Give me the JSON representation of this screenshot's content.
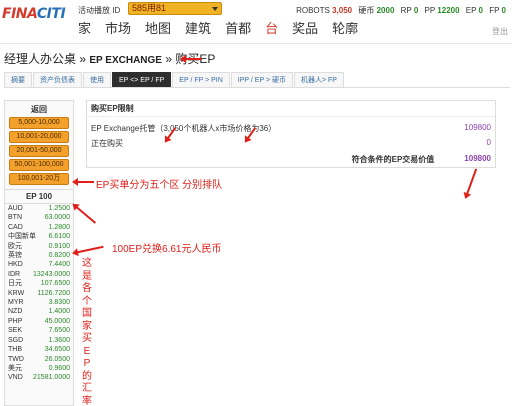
{
  "header": {
    "logo_part1": "FINA",
    "logo_part2": "CITI",
    "live_label": "活动播放 ID",
    "live_value": "585用81",
    "stats": [
      {
        "label": "ROBOTS",
        "value": "3,050"
      },
      {
        "label": "硬币",
        "value": "2000"
      },
      {
        "label": "RP",
        "value": "0"
      },
      {
        "label": "PP",
        "value": "12200"
      },
      {
        "label": "EP",
        "value": "0"
      },
      {
        "label": "FP",
        "value": "0"
      }
    ],
    "nav": [
      "家",
      "市场",
      "地图",
      "建筑",
      "首都",
      "台",
      "奖品",
      "轮廓"
    ],
    "nav_active_index": 5,
    "logout": "登出"
  },
  "breadcrumb": {
    "part1": "经理人办公桌",
    "sep1": " » ",
    "part2": "EP EXCHANGE",
    "sep2": " » ",
    "part3": "购买EP"
  },
  "tabs": [
    "摘要",
    "资产负债表",
    "使用",
    "EP <> EP / FP",
    "EP / FP > PIN",
    "IPP / EP > 硬币",
    "机器人> FP"
  ],
  "active_tab": 3,
  "left_panel": {
    "back": "返回",
    "ranges": [
      "5,000-10,000",
      "10,001-20,000",
      "20,001-50,000",
      "50,001-100,000",
      "100,001-20万"
    ],
    "ep_header": "EP 100",
    "rates": [
      {
        "cur": "AUD",
        "val": "1.2500"
      },
      {
        "cur": "BTN",
        "val": "63.0000"
      },
      {
        "cur": "CAD",
        "val": "1.2800"
      },
      {
        "cur": "中国新单",
        "val": "6.6100"
      },
      {
        "cur": "欧元",
        "val": "0.9100"
      },
      {
        "cur": "英镑",
        "val": "0.8200"
      },
      {
        "cur": "HKD",
        "val": "7.4400"
      },
      {
        "cur": "IDR",
        "val": "13243.0000"
      },
      {
        "cur": "日元",
        "val": "107.6500"
      },
      {
        "cur": "KRW",
        "val": "1126.7200"
      },
      {
        "cur": "MYR",
        "val": "3.8300"
      },
      {
        "cur": "NZD",
        "val": "1.4000"
      },
      {
        "cur": "PHP",
        "val": "45.0000"
      },
      {
        "cur": "SEK",
        "val": "7.6500"
      },
      {
        "cur": "SGD",
        "val": "1.3600"
      },
      {
        "cur": "THB",
        "val": "34.6500"
      },
      {
        "cur": "TWD",
        "val": "26.0500"
      },
      {
        "cur": "美元",
        "val": "0.9600"
      },
      {
        "cur": "VND",
        "val": "21581.0000"
      }
    ]
  },
  "right_panel": {
    "title": "购买EP限制",
    "rows": [
      {
        "label": "EP Exchange托管（3,050个机器人x市场价格为36）",
        "value": "109800"
      },
      {
        "label": "正在购买",
        "value": "0"
      }
    ],
    "total_label": "符合条件的EP交易价值",
    "total_value": "109800"
  },
  "annotations": {
    "split": "EP买单分为五个区 分别排队",
    "rmb": "100EP兑换6.61元人民币",
    "vertical": "这是各个国家买EP的汇率"
  },
  "colors": {
    "accent": "#f3a12b",
    "annotation": "#e0201a",
    "value_purple": "#8e44ad",
    "rate_green": "#2a8a2a"
  }
}
